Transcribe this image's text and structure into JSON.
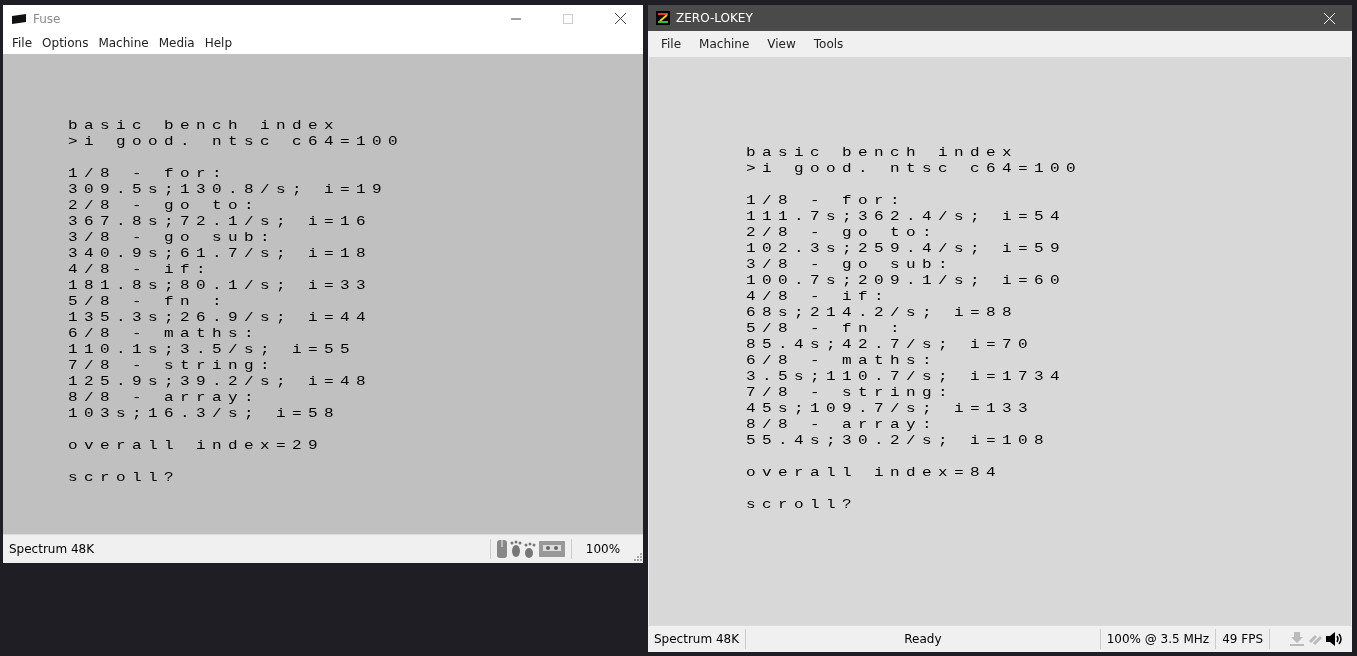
{
  "windows": [
    {
      "kind": "fuse",
      "title": "Fuse",
      "menu": [
        "File",
        "Options",
        "Machine",
        "Media",
        "Help"
      ],
      "screen": [
        [
          "basic bench index",
          ">i good. ntsc c64=100"
        ],
        [
          "1/8 - for:",
          "309.5s;130.8/s; i=19",
          "2/8 - go to:",
          "367.8s;72.1/s; i=16",
          "3/8 - go sub:",
          "340.9s;61.7/s; i=18",
          "4/8 - if:",
          "181.8s;80.1/s; i=33",
          "5/8 - fn :",
          "135.3s;26.9/s; i=44",
          "6/8 - maths:",
          "110.1s;3.5/s; i=55",
          "7/8 - string:",
          "125.9s;39.2/s; i=48",
          "8/8 - array:",
          "103s;16.3/s; i=58"
        ],
        [
          "overall index=29"
        ],
        [
          "scroll?"
        ]
      ],
      "status": [
        "Spectrum 48K",
        "100%"
      ]
    },
    {
      "kind": "zero",
      "title": "ZERO-LOKEY",
      "menu": [
        "File",
        "Machine",
        "View",
        "Tools"
      ],
      "screen": [
        [
          "basic bench index",
          ">i good. ntsc c64=100"
        ],
        [
          "1/8 - for:",
          "111.7s;362.4/s; i=54",
          "2/8 - go to:",
          "102.3s;259.4/s; i=59",
          "3/8 - go sub:",
          "100.7s;209.1/s; i=60",
          "4/8 - if:",
          "68s;214.2/s; i=88",
          "5/8 - fn :",
          "85.4s;42.7/s; i=70",
          "6/8 - maths:",
          "3.5s;110.7/s; i=1734",
          "7/8 - string:",
          "45s;109.7/s; i=133",
          "8/8 - array:",
          "55.4s;30.2/s; i=108"
        ],
        [
          "overall index=84"
        ],
        [
          "scroll?"
        ]
      ],
      "status": [
        "Spectrum 48K",
        "Ready",
        "100% @ 3.5 MHz",
        "49 FPS"
      ]
    }
  ]
}
